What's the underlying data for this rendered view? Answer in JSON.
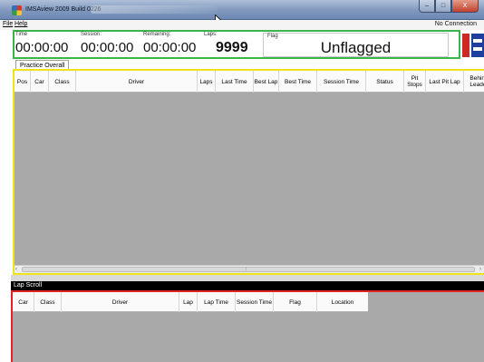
{
  "window": {
    "title": "IMSAview 2009 Build 0226",
    "buttons": {
      "minimize": "–",
      "maximize": "□",
      "close": "X"
    }
  },
  "menu": {
    "items": [
      "File",
      "Help"
    ],
    "connection_status": "No Connection"
  },
  "timing": {
    "time_label": "Time",
    "time_value": "00:00:00",
    "session_label": "Session:",
    "session_value": "00:00:00",
    "remaining_label": "Remaining:",
    "remaining_value": "00:00:00",
    "laps_label": "Laps:",
    "laps_value": "9999",
    "flag_label": "Flag",
    "flag_value": "Unflagged"
  },
  "logo_text": "IMSA",
  "colors": {
    "timing_border": "#3bb64a",
    "practice_border": "#f1e21a",
    "lap_border": "#e32222",
    "grid_background": "#a9a9a9"
  },
  "tabs": [
    {
      "label": "Practice Overall",
      "selected": true
    }
  ],
  "practice_columns": [
    "Pos",
    "Car",
    "Class",
    "Driver",
    "Laps",
    "Last Time",
    "Best Lap",
    "Best Time",
    "Session Time",
    "Status",
    "Pit Stops",
    "Last Pit Lap",
    "Behind Leader"
  ],
  "lap_scroll": {
    "title": "Lap Scroll",
    "columns": [
      "Car",
      "Class",
      "Driver",
      "Lap",
      "Lap Time",
      "Session Time",
      "Flag",
      "Location"
    ]
  }
}
